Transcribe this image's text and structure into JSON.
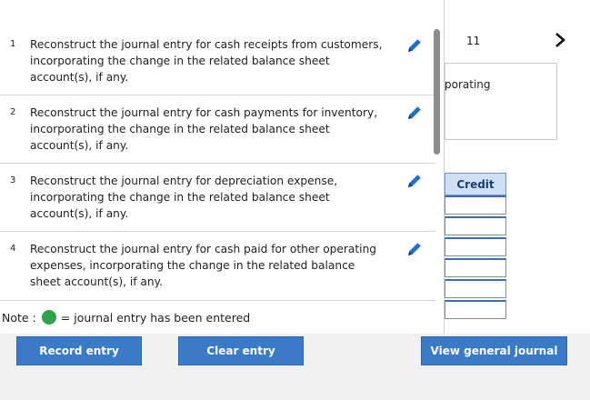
{
  "entries": [
    {
      "num": "1",
      "text": "Reconstruct the journal entry for cash receipts from customers, incorporating the change in the related balance sheet account(s), if any."
    },
    {
      "num": "2",
      "text": "Reconstruct the journal entry for cash payments for inventory, incorporating the change in the related balance sheet account(s), if any."
    },
    {
      "num": "3",
      "text": "Reconstruct the journal entry for depreciation expense, incorporating the change in the related balance sheet account(s), if any."
    },
    {
      "num": "4",
      "text": "Reconstruct the journal entry for cash paid for other operating expenses, incorporating the change in the related balance sheet account(s), if any."
    }
  ],
  "note": {
    "label": "Note :",
    "text": "= journal entry has been entered",
    "dot_color": "#2fa34a"
  },
  "background": {
    "page_number": "11",
    "partial_text": "porating",
    "credit_header": "Credit"
  },
  "buttons": {
    "record": "Record entry",
    "clear": "Clear entry",
    "view": "View general journal"
  },
  "icons": {
    "edit": "pencil-icon",
    "next": "chevron-right-icon"
  },
  "colors": {
    "button_blue": "#3a7bc8",
    "pencil_blue": "#1f6fd1",
    "credit_header_bg": "#cfe0f4"
  }
}
